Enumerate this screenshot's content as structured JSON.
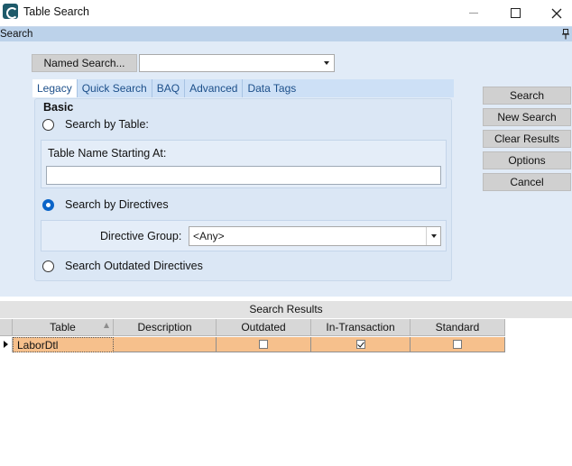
{
  "window": {
    "title": "Table Search",
    "icon": "epicor-e-icon"
  },
  "section_header": {
    "label": "Search"
  },
  "named_search": {
    "button_label": "Named Search...",
    "value": ""
  },
  "tabs": [
    {
      "label": "Legacy",
      "active": true
    },
    {
      "label": "Quick Search",
      "active": false
    },
    {
      "label": "BAQ",
      "active": false
    },
    {
      "label": "Advanced",
      "active": false
    },
    {
      "label": "Data Tags",
      "active": false
    }
  ],
  "basic": {
    "title": "Basic",
    "search_by_table_label": "Search by Table:",
    "table_name_label": "Table Name Starting At:",
    "table_name_value": "",
    "search_by_directives_label": "Search by Directives",
    "directive_group_label": "Directive Group:",
    "directive_group_value": "<Any>",
    "search_outdated_label": "Search Outdated Directives",
    "selected_option": "search_by_directives"
  },
  "actions": {
    "search": "Search",
    "new_search": "New Search",
    "clear_results": "Clear Results",
    "options": "Options",
    "cancel": "Cancel"
  },
  "results": {
    "header": "Search Results",
    "columns": [
      "Table",
      "Description",
      "Outdated",
      "In-Transaction",
      "Standard"
    ],
    "sort_column": "Table",
    "rows": [
      {
        "table": "LaborDtl",
        "description": "",
        "outdated": false,
        "in_transaction": true,
        "standard": false,
        "selected": true
      }
    ]
  },
  "colors": {
    "section_header": "#bcd2ea",
    "search_area": "#e1ebf7",
    "selected_row": "#f6c08c",
    "radio_selected": "#0a64c8",
    "tab_text": "#1c4f8a"
  }
}
